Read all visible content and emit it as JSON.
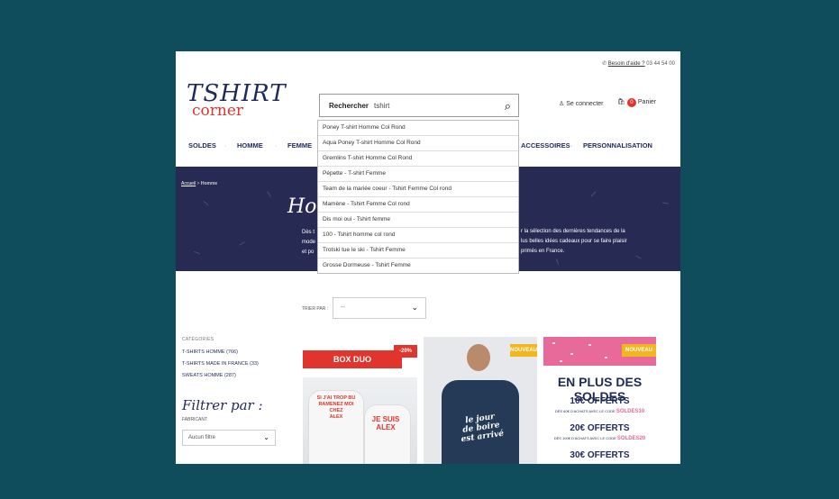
{
  "topbar": {
    "help_link": "Besoin d'aide ?",
    "phone": "03 44 54 00"
  },
  "logo": {
    "line1": "TSHIRT",
    "line2": "corner"
  },
  "search": {
    "label": "Rechercher",
    "value": "tshirt"
  },
  "header": {
    "login": "Se connecter",
    "cart_count": "0",
    "cart_label": "Panier"
  },
  "nav": {
    "items": [
      "SOLDES",
      "HOMME",
      "FEMME",
      "ACCESSOIRES",
      "PERSONNALISATION"
    ]
  },
  "suggestions": [
    "Poney T-shirt Homme Col Rond",
    "Aqua Poney T-shirt Homme Col Rond",
    "Gremlins T-shirt Homme Col Rond",
    "Pépette - T-shirt Femme",
    "Team de la mariée coeur - Tshirt Femme Col rond",
    "Mamène - Tshirt Femme Col rond",
    "Dis moi oui - Tshirt femme",
    "100 - Tshirt homme col rond",
    "Trotski tue le ski - Tshirt Femme",
    "Grosse Dormeuse - Tshirt Femme"
  ],
  "hero": {
    "breadcrumb_home": "Accueil",
    "breadcrumb_current": "Homme",
    "title": "Hom",
    "left_text": "Dès t\nmode\net po",
    "right_text": "r la sélection des dernières tendances de la\nlus belles idées cadeaux pour se faire plaisir\nprimés en France."
  },
  "sort": {
    "label": "TRIER PAR :",
    "value": "--"
  },
  "sidebar": {
    "categories_title": "CATÉGORIES",
    "categories": [
      "T-SHIRTS HOMME (766)",
      "T-SHIRTS MADE IN FRANCE (33)",
      "SWEATS HOMME (287)"
    ],
    "filter_title": "Filtrer par :",
    "manufacturer_label": "FABRICANT",
    "filter_value": "Aucun filtre"
  },
  "products": [
    {
      "banner": "BOX DUO",
      "discount": "-20%",
      "text1": "SI J'AI TROP BU\nRAMENEZ MOI CHEZ\nALEX",
      "text2": "JE SUIS\nALEX"
    },
    {
      "badge": "NOUVEAU",
      "shirt_text": "le jour\nde boire\nest arrivé"
    },
    {
      "badge": "NOUVEAU",
      "headline": "EN PLUS DES SOLDES",
      "offer1": "10€ OFFERTS",
      "sub1": "DÈS 60€ D'ACHATS AVEC LE CODE",
      "code1": "SOLDES10",
      "offer2": "20€ OFFERTS",
      "sub2": "DÈS 100€ D'ACHATS AVEC LE CODE",
      "code2": "SOLDES20",
      "offer3": "30€ OFFERTS"
    }
  ],
  "colors": {
    "background": "#0f4c5c",
    "navy": "#1e2a5a",
    "red": "#e0342c",
    "hero": "#272a53",
    "yellow": "#f2b61e",
    "pink": "#e76a9a"
  }
}
